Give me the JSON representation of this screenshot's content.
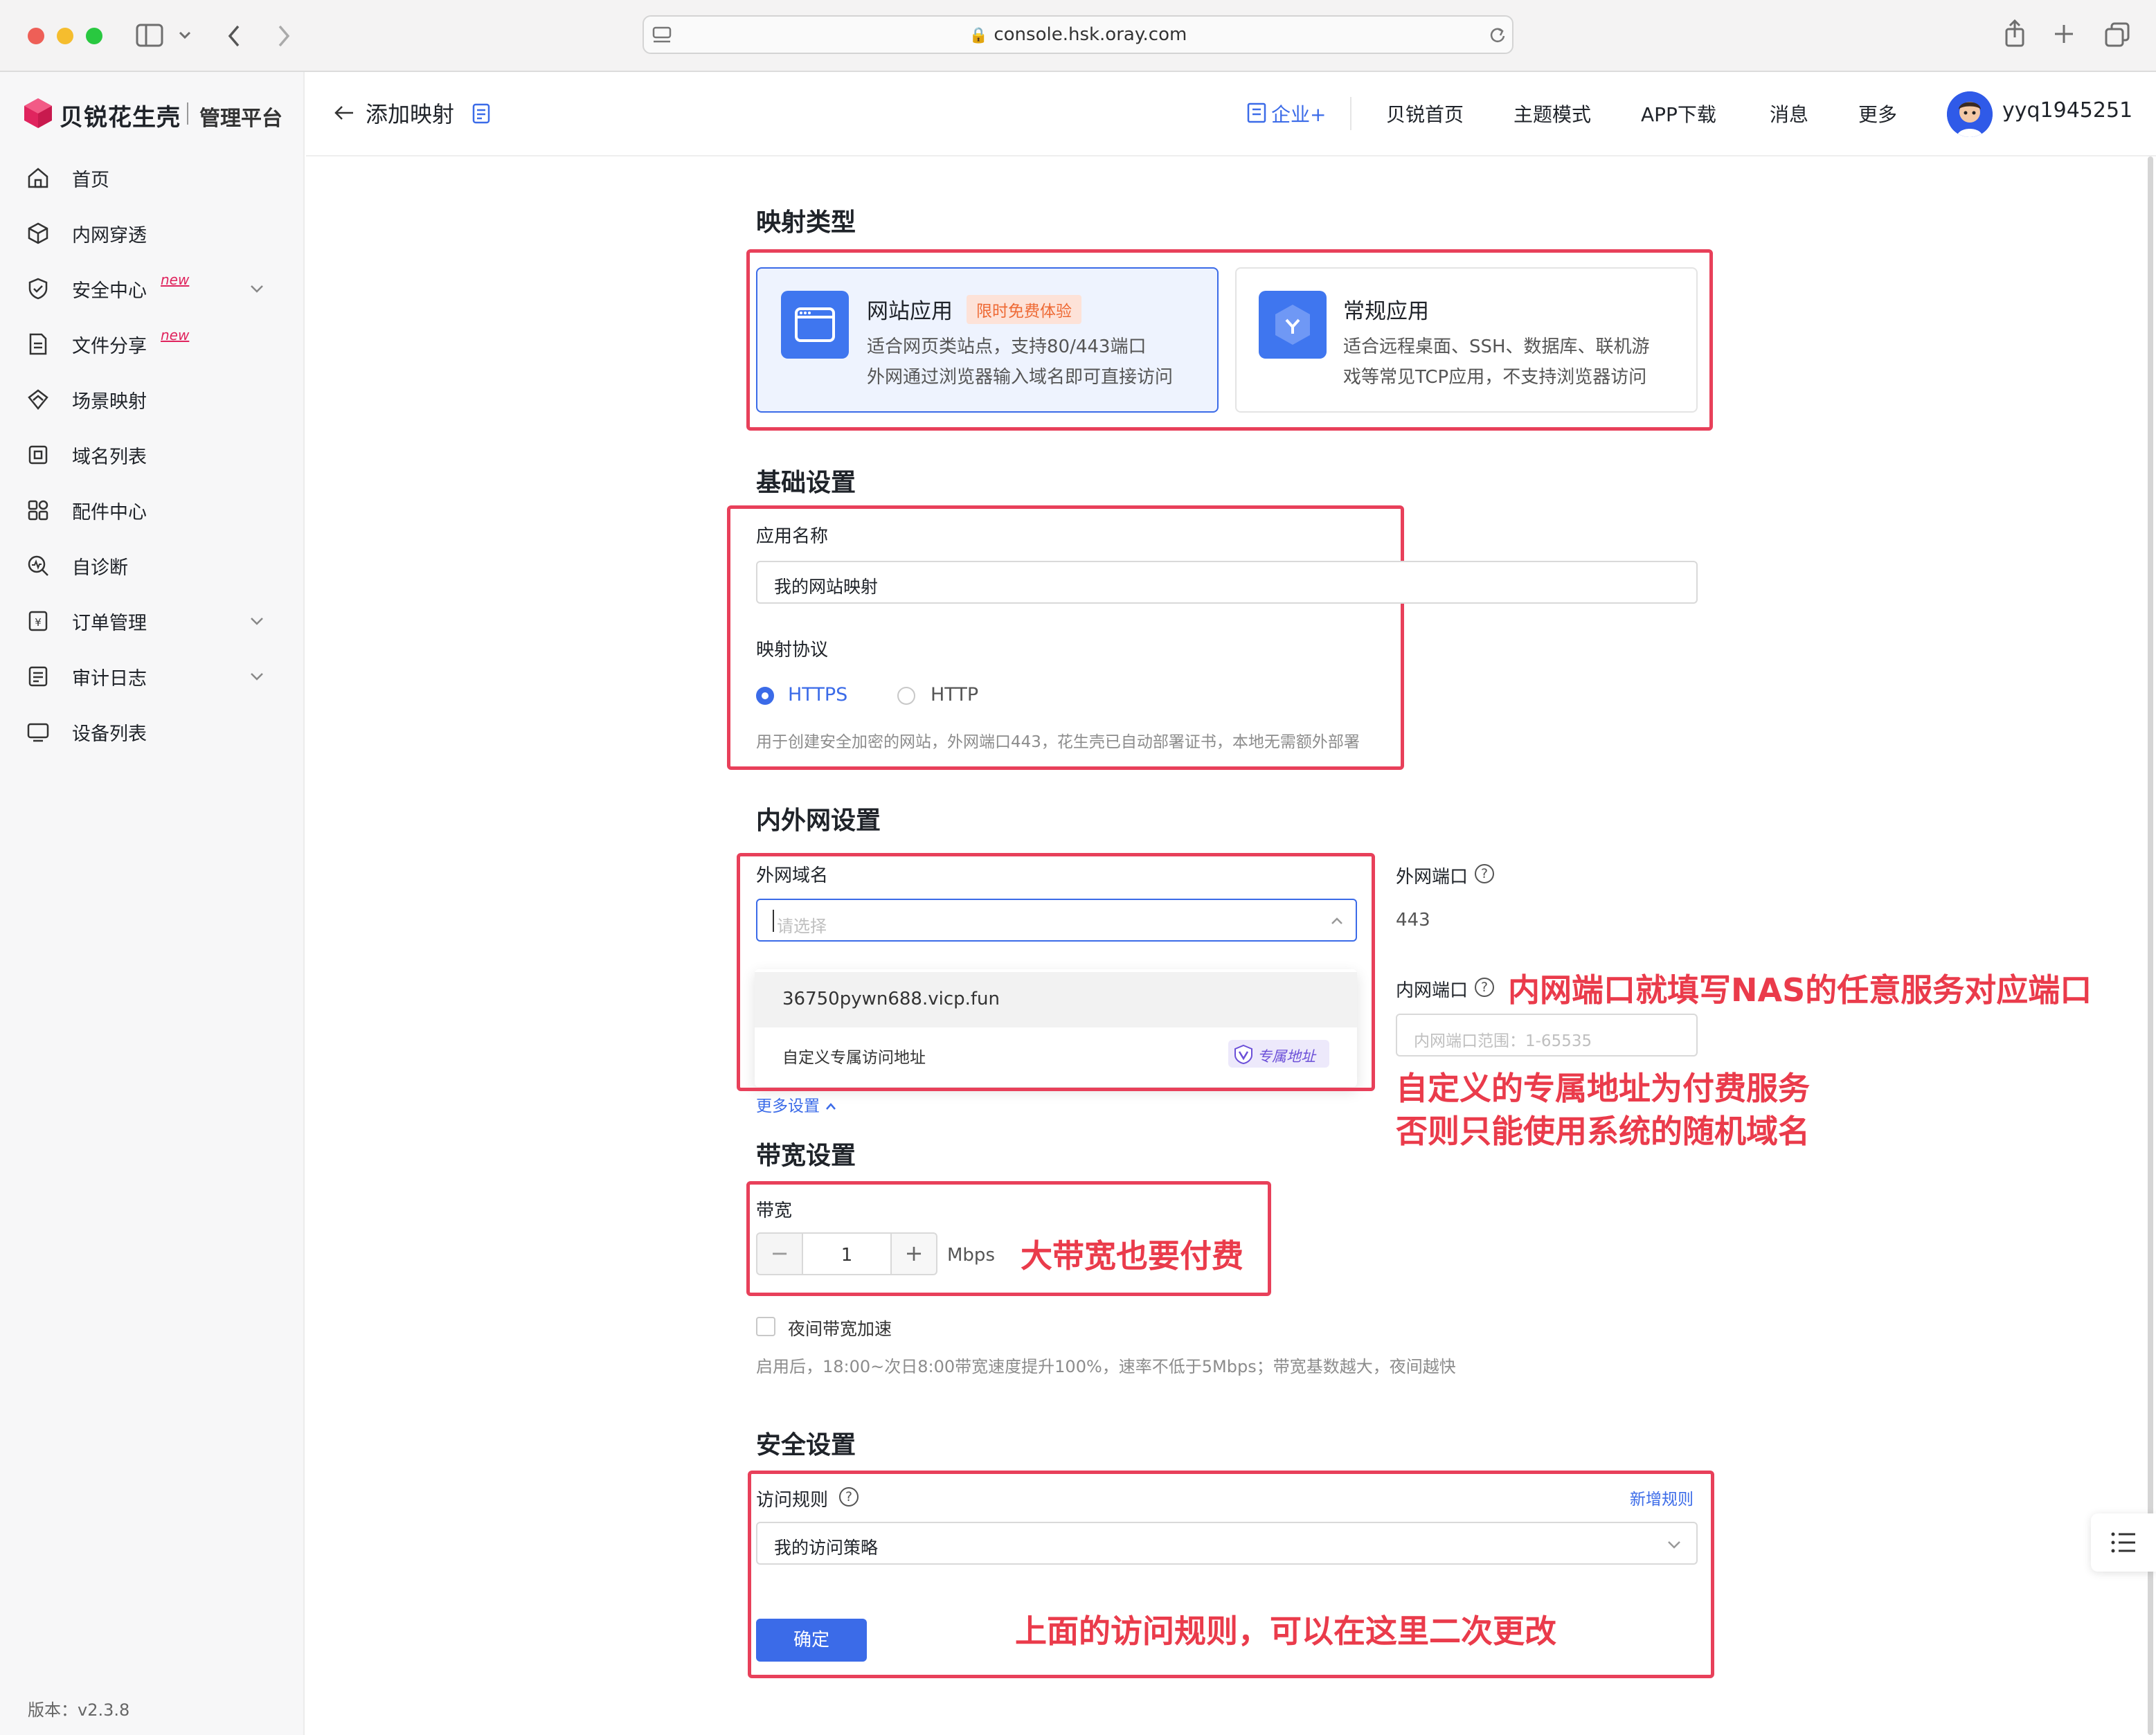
{
  "browser": {
    "url": "console.hsk.oray.com"
  },
  "sidebar": {
    "brand": "贝锐花生壳",
    "sub_brand": "管理平台",
    "items": [
      {
        "label": "首页",
        "icon": "home-icon"
      },
      {
        "label": "内网穿透",
        "icon": "cube-icon"
      },
      {
        "label": "安全中心",
        "icon": "shield-icon",
        "badge": "new",
        "expandable": true
      },
      {
        "label": "文件分享",
        "icon": "file-share-icon",
        "badge": "new"
      },
      {
        "label": "场景映射",
        "icon": "scene-icon"
      },
      {
        "label": "域名列表",
        "icon": "domain-icon"
      },
      {
        "label": "配件中心",
        "icon": "accessory-icon"
      },
      {
        "label": "自诊断",
        "icon": "diagnose-icon"
      },
      {
        "label": "订单管理",
        "icon": "order-icon",
        "expandable": true
      },
      {
        "label": "审计日志",
        "icon": "log-icon",
        "expandable": true
      },
      {
        "label": "设备列表",
        "icon": "device-icon"
      }
    ],
    "version": "版本：v2.3.8"
  },
  "header": {
    "title": "添加映射",
    "links": {
      "enterprise": "企业+",
      "home": "贝锐首页",
      "theme": "主题模式",
      "app": "APP下载",
      "messages": "消息",
      "more": "更多"
    },
    "username": "yyq1945251"
  },
  "mapping_type": {
    "title": "映射类型",
    "web": {
      "title": "网站应用",
      "badge": "限时免费体验",
      "desc1": "适合网页类站点，支持80/443端口",
      "desc2": "外网通过浏览器输入域名即可直接访问"
    },
    "general": {
      "title": "常规应用",
      "desc1": "适合远程桌面、SSH、数据库、联机游",
      "desc2": "戏等常见TCP应用，不支持浏览器访问"
    }
  },
  "basic": {
    "title": "基础设置",
    "app_name_label": "应用名称",
    "app_name_value": "我的网站映射",
    "protocol_label": "映射协议",
    "protocol_https": "HTTPS",
    "protocol_http": "HTTP",
    "protocol_hint": "用于创建安全加密的网站，外网端口443，花生壳已自动部署证书，本地无需额外部署"
  },
  "network": {
    "title": "内外网设置",
    "domain_label": "外网域名",
    "domain_placeholder": "请选择",
    "options": [
      {
        "label": "36750pywn688.vicp.fun"
      },
      {
        "label": "自定义专属访问地址",
        "tag": "专属地址"
      }
    ],
    "more_settings": "更多设置",
    "ext_port_label": "外网端口",
    "ext_port_value": "443",
    "int_port_label": "内网端口",
    "int_port_placeholder": "内网端口范围：1-65535"
  },
  "bandwidth": {
    "title": "带宽设置",
    "label": "带宽",
    "value": "1",
    "unit": "Mbps",
    "night_label": "夜间带宽加速",
    "night_hint": "启用后，18:00~次日8:00带宽速度提升100%，速率不低于5Mbps；带宽基数越大，夜间越快"
  },
  "security": {
    "title": "安全设置",
    "rule_label": "访问规则",
    "add_rule": "新增规则",
    "rule_value": "我的访问策略",
    "confirm": "确定"
  },
  "annotations": {
    "int_port": "内网端口就填写NAS的任意服务对应端口",
    "custom_line1": "自定义的专属地址为付费服务",
    "custom_line2": "否则只能使用系统的随机域名",
    "bandwidth": "大带宽也要付费",
    "rule": "上面的访问规则，可以在这里二次更改"
  },
  "colors": {
    "primary": "#3b6be8",
    "annotation": "#e8405a",
    "badge_bg": "#fde2d8",
    "badge_fg": "#ee6a35"
  }
}
